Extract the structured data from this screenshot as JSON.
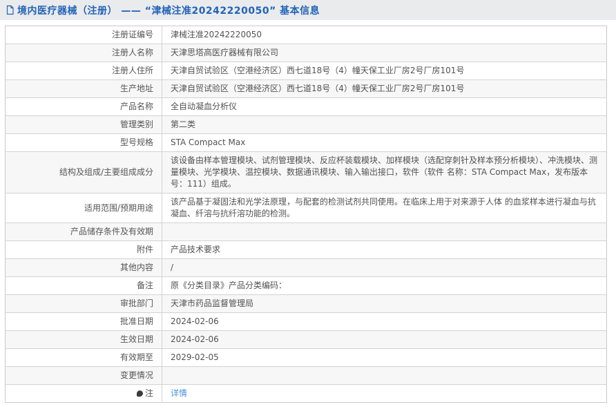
{
  "page": {
    "title": "境内医疗器械（注册） —— “津械注准20242220050” 基本信息"
  },
  "colors": {
    "title_text": "#2263b8",
    "titlebar_bg": "#eaebed",
    "row_alt_bg": "#f7f7f7",
    "table_border": "#c9c9c9",
    "link": "#4a90d9"
  },
  "icons": {
    "title_icon": "document-icon",
    "note_icon": "comment-icon"
  },
  "table": {
    "rows": [
      {
        "label": "注册证编号",
        "value": "津械注准20242220050"
      },
      {
        "label": "注册人名称",
        "value": "天津思塔高医疗器械有限公司"
      },
      {
        "label": "注册人住所",
        "value": "天津自贸试验区（空港经济区）西七道18号（4）幢天保工业厂房2号厂房101号"
      },
      {
        "label": "生产地址",
        "value": "天津自贸试验区（空港经济区）西七道18号（4）幢天保工业厂房2号厂房101号"
      },
      {
        "label": "产品名称",
        "value": "全自动凝血分析仪"
      },
      {
        "label": "管理类别",
        "value": "第二类"
      },
      {
        "label": "型号规格",
        "value": "STA Compact Max"
      },
      {
        "label": "结构及组成/主要组成成分",
        "value": "该设备由样本管理模块、试剂管理模块、反应杯装载模块、加样模块（选配穿刺针及样本预分析模块）、冲洗模块、测量模块、光学模块、温控模块、数据通讯模块、输入输出接口，软件（软件 名称：STA Compact Max，发布版本号：111）组成。"
      },
      {
        "label": "适用范围/预期用途",
        "value": "该产品基于凝固法和光学法原理，与配套的检测试剂共同使用。在临床上用于对来源于人体 的血浆样本进行凝血与抗凝血、纤溶与抗纤溶功能的检测。"
      },
      {
        "label": "产品储存条件及有效期",
        "value": ""
      },
      {
        "label": "附件",
        "value": "产品技术要求"
      },
      {
        "label": "其他内容",
        "value": "/"
      },
      {
        "label": "备注",
        "value": "原《分类目录》产品分类编码："
      },
      {
        "label": "审批部门",
        "value": "天津市药品监督管理局"
      },
      {
        "label": "批准日期",
        "value": "2024-02-06"
      },
      {
        "label": "生效日期",
        "value": "2024-02-06"
      },
      {
        "label": "有效期至",
        "value": "2029-02-05"
      },
      {
        "label": "变更情况",
        "value": ""
      }
    ]
  },
  "note": {
    "label": "注",
    "link_label": "详情"
  }
}
